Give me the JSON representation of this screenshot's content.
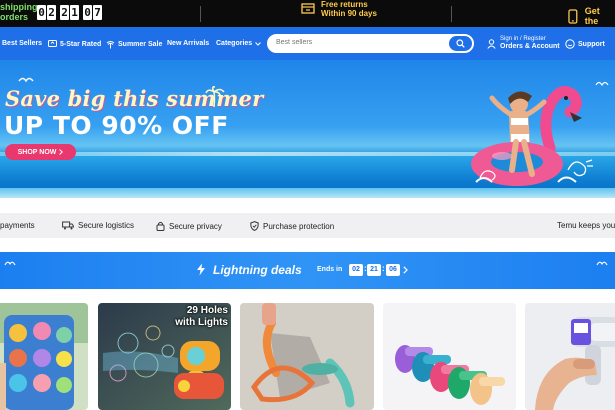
{
  "topbar": {
    "free_shipping_line1": "shipping",
    "free_shipping_line2": "orders",
    "countdown_digits": [
      "0",
      "2",
      "2",
      "1",
      "0",
      "7"
    ],
    "returns_line1": "Free returns",
    "returns_line2": "Within 90 days",
    "app_label": "Get the",
    "accent": "#ffcc4d",
    "green": "#7be069"
  },
  "nav": {
    "items": [
      "Best Sellers",
      "5-Star Rated",
      "Summer Sale",
      "New Arrivals",
      "Categories"
    ],
    "search_placeholder": "Best sellers",
    "account_line1": "Sign in / Register",
    "account_line2": "Orders & Account",
    "support_label": "Support",
    "brand_color": "#1e6fe8"
  },
  "hero": {
    "headline1": "Save big this summer",
    "headline2": "UP TO 90% OFF",
    "cta_label": "SHOP NOW",
    "cta_color": "#e8386d"
  },
  "trust": {
    "items": [
      "payments",
      "Secure logistics",
      "Secure privacy",
      "Purchase protection",
      "Temu keeps your"
    ]
  },
  "deals": {
    "title": "Lightning deals",
    "ends_label": "Ends in",
    "hours": "02",
    "minutes": "21",
    "seconds": "06"
  },
  "products": {
    "tile2_badge_line1": "29 Holes",
    "tile2_badge_line2": "with Lights"
  }
}
